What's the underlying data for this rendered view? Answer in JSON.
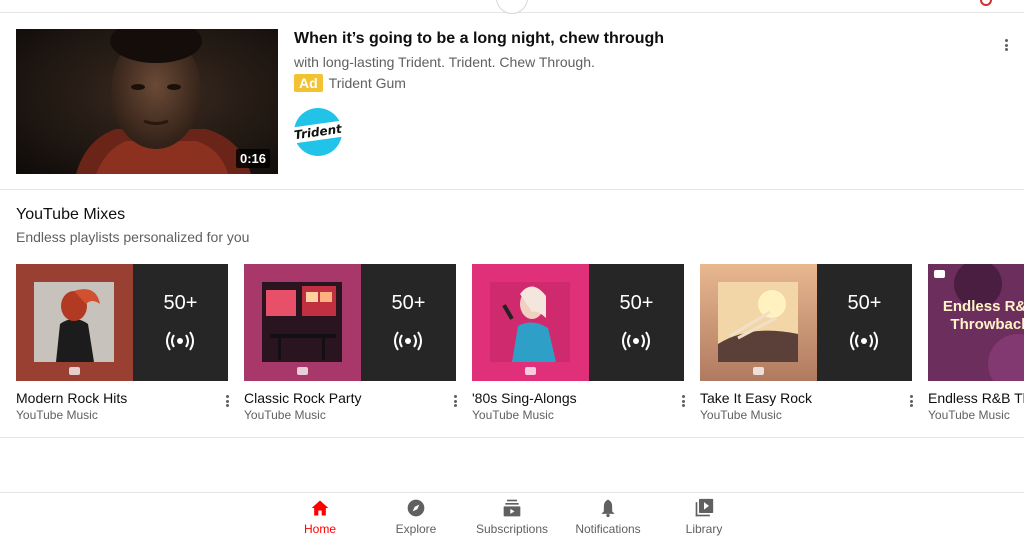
{
  "ad": {
    "title": "When it’s going to be a long night, chew through",
    "description": "with long-lasting Trident. Trident. Chew Through.",
    "badge": "Ad",
    "brand": "Trident Gum",
    "duration": "0:16",
    "logo_text": "Trident"
  },
  "mixes": {
    "title": "YouTube Mixes",
    "subtitle": "Endless playlists personalized for you",
    "items": [
      {
        "name": "Modern Rock Hits",
        "channel": "YouTube Music",
        "count": "50+"
      },
      {
        "name": "Classic Rock Party",
        "channel": "YouTube Music",
        "count": "50+"
      },
      {
        "name": "'80s Sing-Alongs",
        "channel": "YouTube Music",
        "count": "50+"
      },
      {
        "name": "Take It Easy Rock",
        "channel": "YouTube Music",
        "count": "50+"
      },
      {
        "name": "Endless R&B Throwback",
        "channel": "YouTube Music",
        "art_text": "Endless R&B Throwback"
      }
    ]
  },
  "nav": {
    "items": [
      {
        "label": "Home",
        "icon": "home-icon",
        "active": true
      },
      {
        "label": "Explore",
        "icon": "compass-icon"
      },
      {
        "label": "Subscriptions",
        "icon": "subscriptions-icon"
      },
      {
        "label": "Notifications",
        "icon": "bell-icon"
      },
      {
        "label": "Library",
        "icon": "library-icon"
      }
    ]
  },
  "colors": {
    "accent_red": "#ff0000",
    "ad_badge": "#f2c230",
    "trident_blue": "#22c3e8",
    "mix_panel": "#262626"
  }
}
